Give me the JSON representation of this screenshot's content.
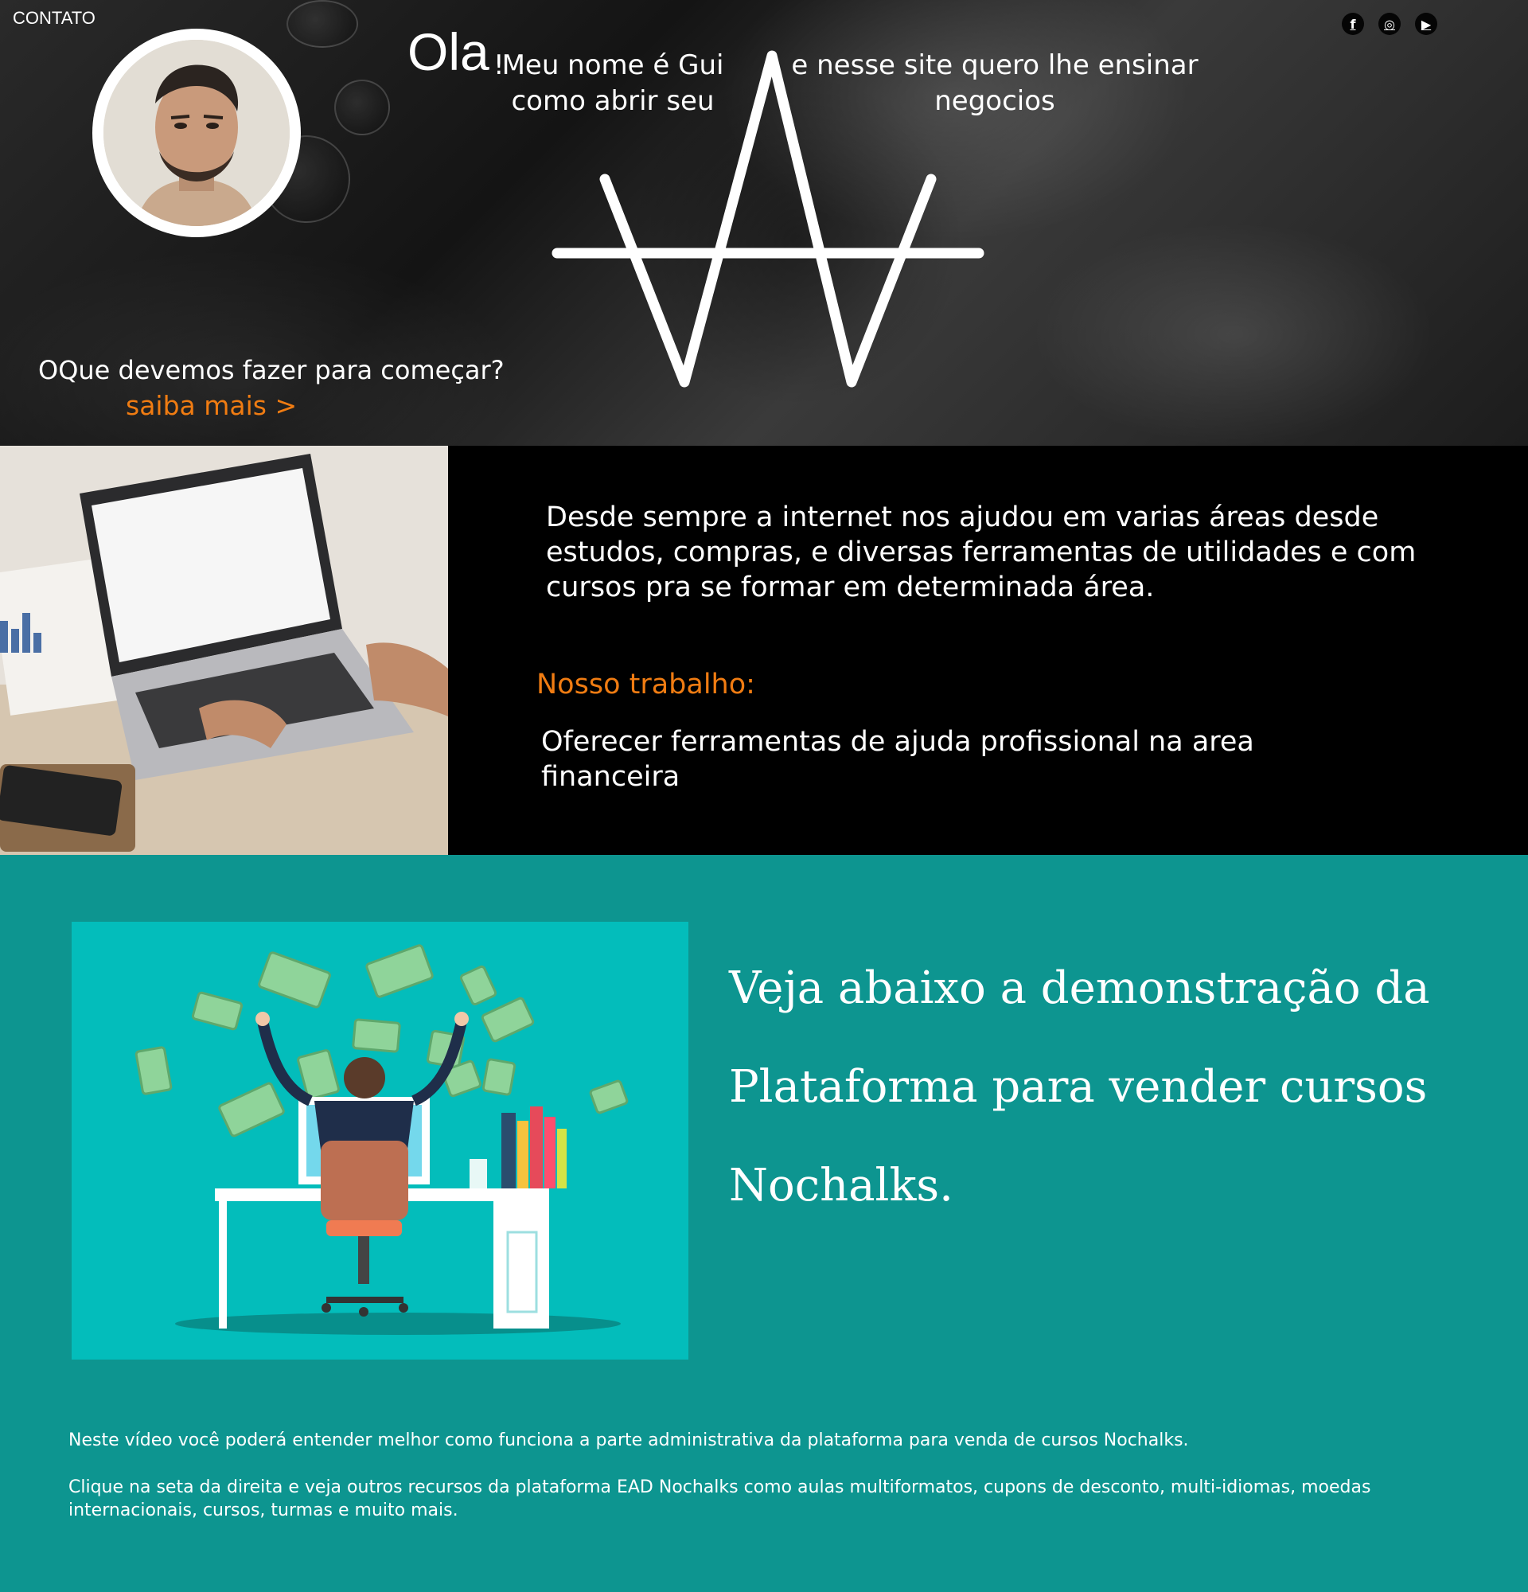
{
  "nav": {
    "contato": "CONTATO"
  },
  "social": [
    {
      "icon": "facebook-icon",
      "glyph": "f"
    },
    {
      "icon": "instagram-icon",
      "glyph": "◎"
    },
    {
      "icon": "youtube-icon",
      "glyph": "▶"
    }
  ],
  "hero": {
    "ola": "Ola",
    "excl": "!",
    "greeting_left": "Meu nome é Gui\ncomo abrir seu",
    "greeting_right": "e nesse site quero lhe ensinar\nnegocios",
    "question": "OQue devemos fazer para começar?",
    "cta": "saiba mais >",
    "accent_color": "#f07c12"
  },
  "intro": {
    "description": "Desde sempre a internet nos ajudou em varias áreas desde estudos, compras, e diversas ferramentas de utilidades e com cursos pra se formar em determinada área.",
    "work_title": "Nosso trabalho:",
    "work_text": "Oferecer ferramentas de ajuda profissional na area financeira"
  },
  "demo": {
    "headline": "Veja abaixo a demonstração da Plataforma para vender cursos Nochalks.",
    "paragraph1": "Neste vídeo você poderá entender melhor como funciona a parte administrativa da plataforma para venda de cursos Nochalks.",
    "paragraph2": "Clique na seta da direita e veja outros recursos da plataforma EAD Nochalks como aulas multiformatos, cupons de desconto, multi-idiomas, moedas internacionais, cursos, turmas e muito mais.",
    "background_color": "#0d9590"
  }
}
